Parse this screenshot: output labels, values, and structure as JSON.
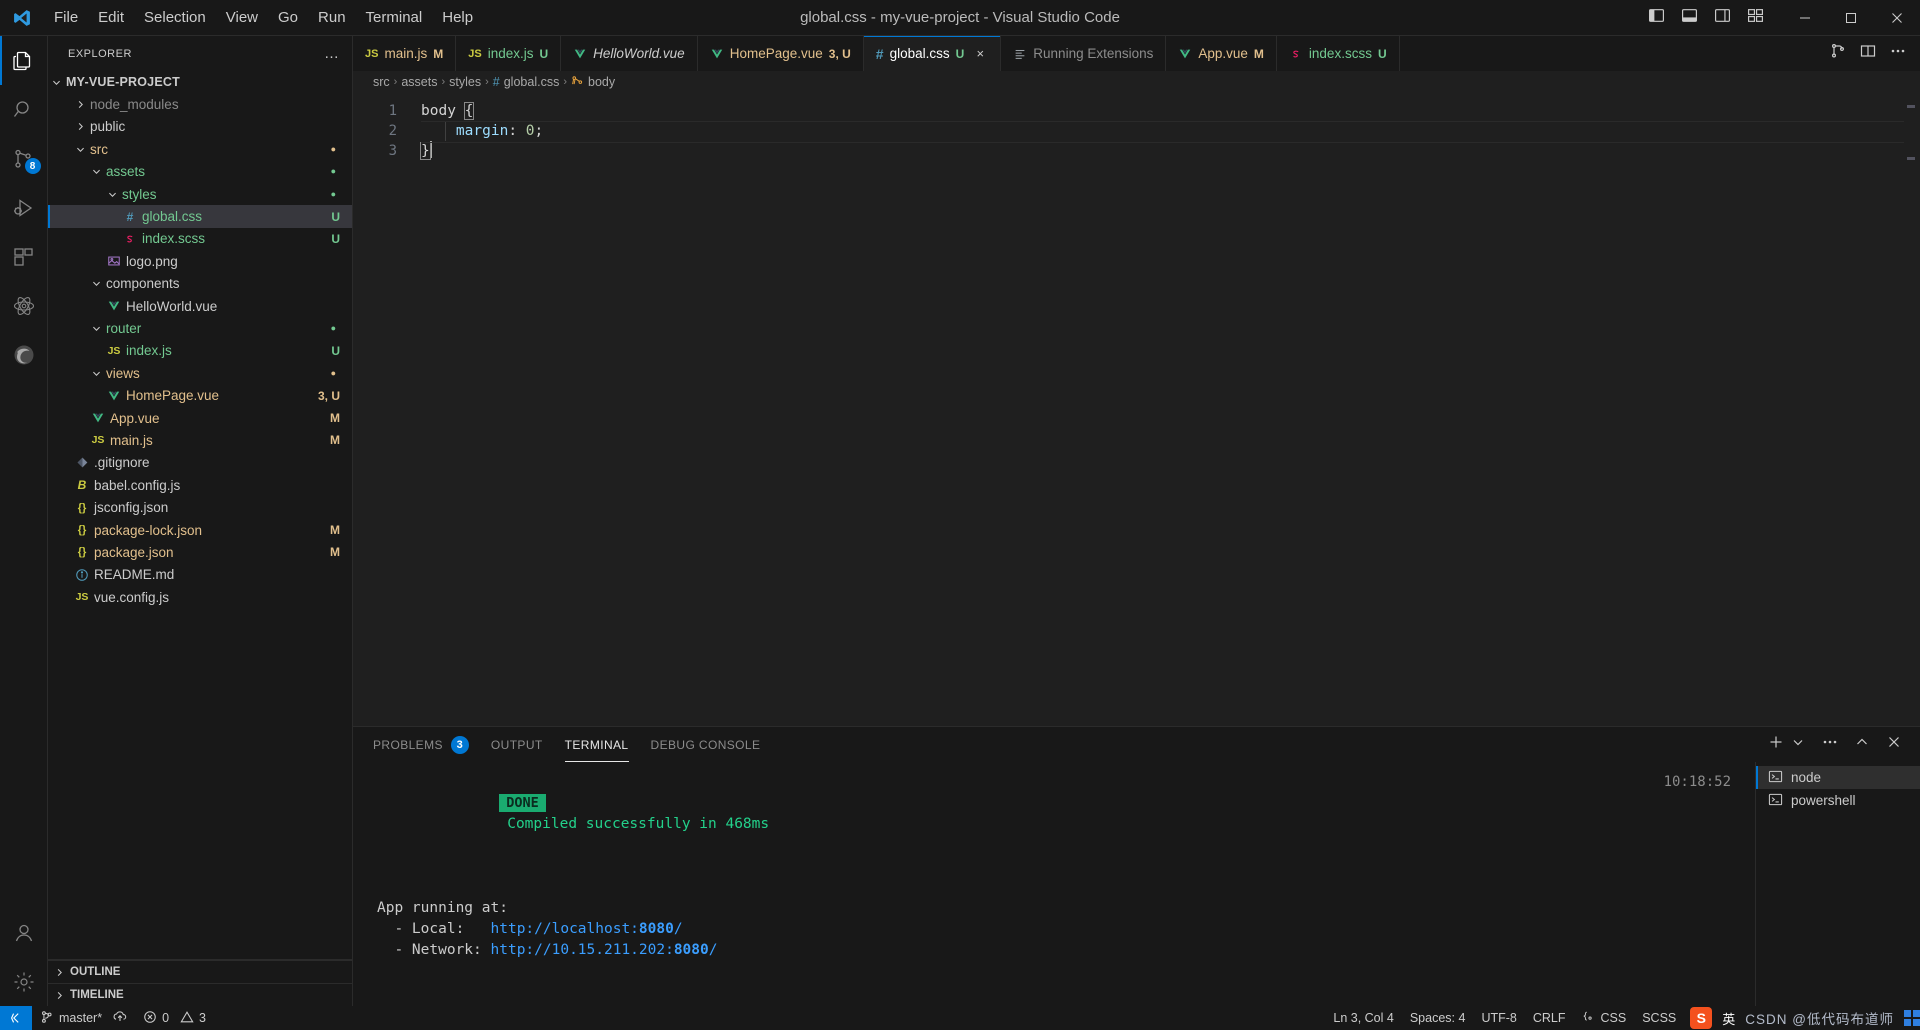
{
  "window": {
    "title": "global.css - my-vue-project - Visual Studio Code",
    "menus": [
      "File",
      "Edit",
      "Selection",
      "View",
      "Go",
      "Run",
      "Terminal",
      "Help"
    ],
    "layout_icons": [
      "toggle-primary-sidebar-icon",
      "toggle-panel-icon",
      "toggle-secondary-sidebar-icon",
      "customize-layout-icon"
    ],
    "controls": [
      "minimize",
      "maximize",
      "close"
    ]
  },
  "activitybar": {
    "items": [
      {
        "name": "explorer",
        "icon": "files-icon",
        "active": true,
        "badge": ""
      },
      {
        "name": "search",
        "icon": "search-icon",
        "active": false,
        "badge": ""
      },
      {
        "name": "source-control",
        "icon": "source-control-icon",
        "active": false,
        "badge": "8"
      },
      {
        "name": "run-and-debug",
        "icon": "debug-icon",
        "active": false,
        "badge": ""
      },
      {
        "name": "extensions",
        "icon": "extensions-icon",
        "active": false,
        "badge": ""
      },
      {
        "name": "react-devtools",
        "icon": "atom-icon",
        "active": false,
        "badge": ""
      },
      {
        "name": "edge-tools",
        "icon": "edge-icon",
        "active": false,
        "badge": ""
      }
    ],
    "bottom": [
      {
        "name": "accounts",
        "icon": "account-icon"
      },
      {
        "name": "manage",
        "icon": "gear-icon"
      }
    ]
  },
  "sidebar": {
    "header": "EXPLORER",
    "more_actions": "…",
    "root": "MY-VUE-PROJECT",
    "tree": [
      {
        "label": "node_modules",
        "type": "folder",
        "depth": 1,
        "expanded": false,
        "color": "#8a8a8a",
        "state": "",
        "dot": ""
      },
      {
        "label": "public",
        "type": "folder",
        "depth": 1,
        "expanded": false,
        "color": "#cccccc",
        "state": "",
        "dot": ""
      },
      {
        "label": "src",
        "type": "folder",
        "depth": 1,
        "expanded": true,
        "color": "#e2c08d",
        "state": "",
        "dot": "#e2c08d"
      },
      {
        "label": "assets",
        "type": "folder",
        "depth": 2,
        "expanded": true,
        "color": "#73c991",
        "state": "",
        "dot": "#73c991"
      },
      {
        "label": "styles",
        "type": "folder",
        "depth": 3,
        "expanded": true,
        "color": "#73c991",
        "state": "",
        "dot": "#73c991"
      },
      {
        "label": "global.css",
        "type": "css",
        "depth": 4,
        "selected": true,
        "color": "#73c991",
        "state": "U",
        "state_color": "#73c991",
        "dot": ""
      },
      {
        "label": "index.scss",
        "type": "scss",
        "depth": 4,
        "color": "#73c991",
        "state": "U",
        "state_color": "#73c991",
        "dot": ""
      },
      {
        "label": "logo.png",
        "type": "image",
        "depth": 3,
        "color": "#cccccc",
        "state": "",
        "dot": ""
      },
      {
        "label": "components",
        "type": "folder",
        "depth": 2,
        "expanded": true,
        "color": "#cccccc",
        "state": "",
        "dot": ""
      },
      {
        "label": "HelloWorld.vue",
        "type": "vue",
        "depth": 3,
        "color": "#cccccc",
        "state": "",
        "dot": ""
      },
      {
        "label": "router",
        "type": "folder",
        "depth": 2,
        "expanded": true,
        "color": "#73c991",
        "state": "",
        "dot": "#73c991"
      },
      {
        "label": "index.js",
        "type": "js",
        "depth": 3,
        "color": "#73c991",
        "state": "U",
        "state_color": "#73c991",
        "dot": ""
      },
      {
        "label": "views",
        "type": "folder",
        "depth": 2,
        "expanded": true,
        "color": "#e2c08d",
        "state": "",
        "dot": "#e2c08d"
      },
      {
        "label": "HomePage.vue",
        "type": "vue",
        "depth": 3,
        "color": "#e2c08d",
        "state": "3, U",
        "state_color": "#e2c08d",
        "dot": ""
      },
      {
        "label": "App.vue",
        "type": "vue",
        "depth": 2,
        "color": "#e2c08d",
        "state": "M",
        "state_color": "#e2c08d",
        "dot": ""
      },
      {
        "label": "main.js",
        "type": "js",
        "depth": 2,
        "color": "#e2c08d",
        "state": "M",
        "state_color": "#e2c08d",
        "dot": ""
      },
      {
        "label": ".gitignore",
        "type": "git",
        "depth": 1,
        "color": "#cccccc",
        "state": "",
        "dot": ""
      },
      {
        "label": "babel.config.js",
        "type": "babel",
        "depth": 1,
        "color": "#cccccc",
        "state": "",
        "dot": ""
      },
      {
        "label": "jsconfig.json",
        "type": "json",
        "depth": 1,
        "color": "#cccccc",
        "state": "",
        "dot": ""
      },
      {
        "label": "package-lock.json",
        "type": "json",
        "depth": 1,
        "color": "#e2c08d",
        "state": "M",
        "state_color": "#e2c08d",
        "dot": ""
      },
      {
        "label": "package.json",
        "type": "json",
        "depth": 1,
        "color": "#e2c08d",
        "state": "M",
        "state_color": "#e2c08d",
        "dot": ""
      },
      {
        "label": "README.md",
        "type": "readme",
        "depth": 1,
        "color": "#cccccc",
        "state": "",
        "dot": ""
      },
      {
        "label": "vue.config.js",
        "type": "js",
        "depth": 1,
        "color": "#cccccc",
        "state": "",
        "dot": ""
      }
    ],
    "sections": [
      "OUTLINE",
      "TIMELINE"
    ]
  },
  "editor": {
    "tabs": [
      {
        "label": "main.js",
        "icon": "js-icon",
        "state": "M",
        "state_color": "#e2c08d",
        "label_color": "#e2c08d",
        "active": false,
        "italic": false,
        "closable": false
      },
      {
        "label": "index.js",
        "icon": "js-icon",
        "state": "U",
        "state_color": "#73c991",
        "label_color": "#73c991",
        "active": false,
        "italic": false,
        "closable": false
      },
      {
        "label": "HelloWorld.vue",
        "icon": "vue-icon",
        "state": "",
        "state_color": "",
        "label_color": "#cccccc",
        "active": false,
        "italic": true,
        "closable": false
      },
      {
        "label": "HomePage.vue",
        "icon": "vue-icon",
        "state": "3, U",
        "state_color": "#e2c08d",
        "label_color": "#e2c08d",
        "active": false,
        "italic": false,
        "closable": false
      },
      {
        "label": "global.css",
        "icon": "css-icon",
        "state": "U",
        "state_color": "#73c991",
        "label_color": "#ffffff",
        "active": true,
        "italic": false,
        "closable": true
      },
      {
        "label": "Running Extensions",
        "icon": "list-icon",
        "state": "",
        "state_color": "",
        "label_color": "#8c8c8c",
        "active": false,
        "italic": false,
        "closable": false
      },
      {
        "label": "App.vue",
        "icon": "vue-icon",
        "state": "M",
        "state_color": "#e2c08d",
        "label_color": "#e2c08d",
        "active": false,
        "italic": false,
        "closable": false
      },
      {
        "label": "index.scss",
        "icon": "scss-icon",
        "state": "U",
        "state_color": "#73c991",
        "label_color": "#73c991",
        "active": false,
        "italic": false,
        "closable": false
      }
    ],
    "tab_actions": [
      "split-editor-icon",
      "more-actions-icon"
    ],
    "close_label": "×",
    "breadcrumbs": [
      {
        "label": "src",
        "icon": ""
      },
      {
        "label": "assets",
        "icon": ""
      },
      {
        "label": "styles",
        "icon": ""
      },
      {
        "label": "global.css",
        "icon": "css-icon"
      },
      {
        "label": "body",
        "icon": "css-selector-icon"
      }
    ],
    "line_numbers": [
      "1",
      "2",
      "3"
    ],
    "code": [
      {
        "tokens": [
          {
            "t": "body",
            "c": "sel"
          },
          {
            "t": " ",
            "c": "punc"
          },
          {
            "t": "{",
            "c": "brace"
          }
        ]
      },
      {
        "tokens": [
          {
            "t": "    ",
            "c": "punc"
          },
          {
            "t": "margin",
            "c": "prop"
          },
          {
            "t": ": ",
            "c": "punc"
          },
          {
            "t": "0",
            "c": "num"
          },
          {
            "t": ";",
            "c": "punc"
          }
        ]
      },
      {
        "tokens": [
          {
            "t": "}",
            "c": "brace"
          }
        ]
      }
    ]
  },
  "panel": {
    "tabs": [
      {
        "label": "PROBLEMS",
        "badge": "3",
        "active": false
      },
      {
        "label": "OUTPUT",
        "badge": "",
        "active": false
      },
      {
        "label": "TERMINAL",
        "badge": "",
        "active": true
      },
      {
        "label": "DEBUG CONSOLE",
        "badge": "",
        "active": false
      }
    ],
    "actions": [
      "new-terminal-icon",
      "terminal-dropdown-icon",
      "more-actions-icon",
      "maximize-panel-icon",
      "close-panel-icon"
    ],
    "terminal": {
      "status_badge": "DONE",
      "status_text": "Compiled successfully in 468ms",
      "timestamp": "10:18:52",
      "heading": "App running at:",
      "local_label": "  - Local:   ",
      "local_url_prefix": "http://localhost:",
      "local_port": "8080",
      "local_suffix": "/",
      "network_label": "  - Network: ",
      "network_url_prefix": "http://10.15.211.202:",
      "network_port": "8080",
      "network_suffix": "/"
    },
    "terminal_list": [
      {
        "label": "node",
        "icon": "terminal-icon",
        "active": true
      },
      {
        "label": "powershell",
        "icon": "terminal-icon",
        "active": false
      }
    ]
  },
  "statusbar": {
    "remote_icon": "remote-window-icon",
    "branch": "master*",
    "sync_icon": "sync-icon",
    "errors": "0",
    "warnings": "3",
    "position": "Ln 3, Col 4",
    "spaces": "Spaces: 4",
    "encoding": "UTF-8",
    "eol": "CRLF",
    "language": "CSS",
    "language_secondary": "SCSS",
    "ime": {
      "logo": "S",
      "lang": "英",
      "watermark": "CSDN @低代码布道师"
    }
  },
  "colors": {
    "accent": "#0078d4",
    "titlebar_bg": "#181818",
    "editor_bg": "#1f1f1f",
    "sidebar_bg": "#181818",
    "green": "#73c991",
    "orange": "#e2c08d",
    "terminal_green": "#23d18b",
    "terminal_blue": "#3b9eff"
  }
}
